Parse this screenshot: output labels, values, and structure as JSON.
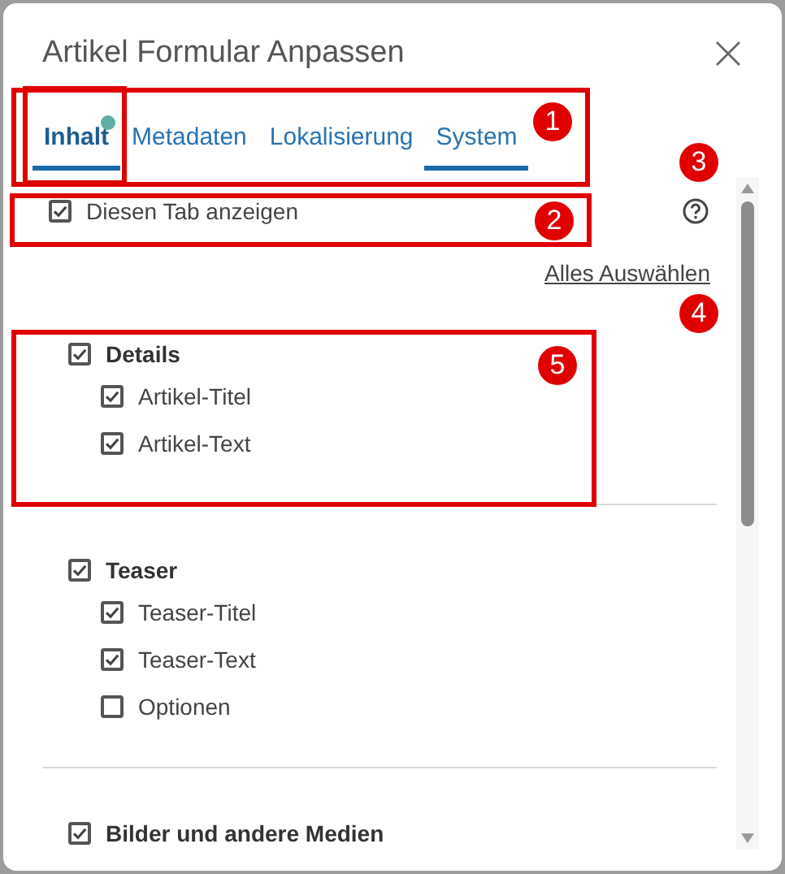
{
  "dialog": {
    "title": "Artikel Formular Anpassen"
  },
  "tabs": [
    {
      "label": "Inhalt",
      "selected": true,
      "underlined": true,
      "badge": true
    },
    {
      "label": "Metadaten",
      "selected": false,
      "underlined": false,
      "badge": false
    },
    {
      "label": "Lokalisierung",
      "selected": false,
      "underlined": false,
      "badge": false
    },
    {
      "label": "System",
      "selected": false,
      "underlined": true,
      "badge": false
    }
  ],
  "show_tab": {
    "label": "Diesen Tab anzeigen",
    "checked": true
  },
  "select_all_link": "Alles Auswählen",
  "groups": [
    {
      "label": "Details",
      "checked": true,
      "children": [
        {
          "label": "Artikel-Titel",
          "checked": true
        },
        {
          "label": "Artikel-Text",
          "checked": true
        }
      ]
    },
    {
      "label": "Teaser",
      "checked": true,
      "children": [
        {
          "label": "Teaser-Titel",
          "checked": true
        },
        {
          "label": "Teaser-Text",
          "checked": true
        },
        {
          "label": "Optionen",
          "checked": false
        }
      ]
    },
    {
      "label": "Bilder und andere Medien",
      "checked": true
    }
  ],
  "annotations": [
    {
      "label": "1"
    },
    {
      "label": "2"
    },
    {
      "label": "3"
    },
    {
      "label": "4"
    },
    {
      "label": "5"
    }
  ]
}
